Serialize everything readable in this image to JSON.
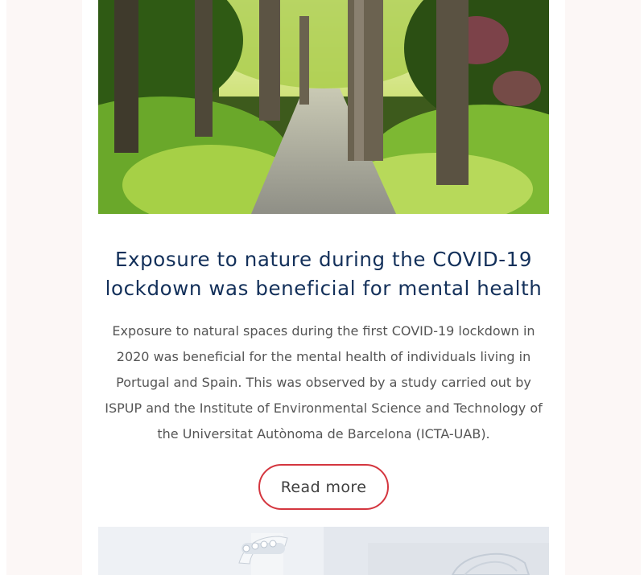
{
  "article": {
    "image_subject": "tree-lined park path",
    "title": "Exposure to nature during the COVID-19 lockdown was beneficial for mental health",
    "summary": "Exposure to natural spaces during the first COVID-19 lockdown in 2020 was beneficial for the mental health of individuals living in Portugal and Spain. This was observed by a study carried out by ISPUP and the Institute of Environmental Science and Technology of the Universitat Autònoma de Barcelona (ICTA-UAB).",
    "read_more_label": "Read more"
  },
  "next_article": {
    "image_subject": "dental clinic equipment"
  },
  "colors": {
    "title": "#13305a",
    "button_border": "#d4363f",
    "page_background": "#fcf7f6"
  }
}
